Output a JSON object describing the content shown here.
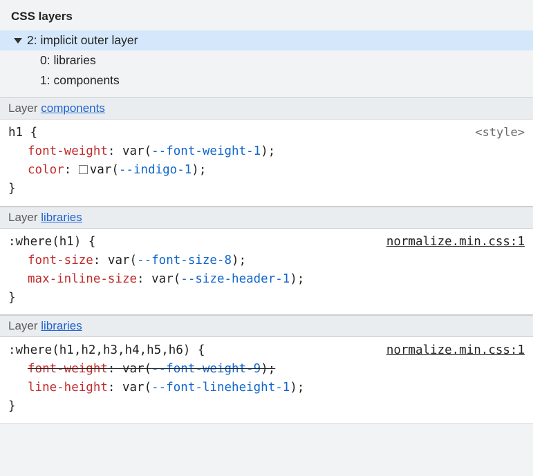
{
  "panel": {
    "title": "CSS layers"
  },
  "tree": {
    "root_label": "2: implicit outer layer",
    "children": [
      {
        "label": "0: libraries"
      },
      {
        "label": "1: components"
      }
    ]
  },
  "sections": [
    {
      "header_prefix": "Layer ",
      "header_link": "components",
      "selector": "h1 {",
      "source": "<style>",
      "source_is_link": false,
      "decls": [
        {
          "name": "font-weight",
          "val_prefix": "var(",
          "var": "--font-weight-1",
          "val_suffix": ");",
          "swatch": false,
          "strike": false
        },
        {
          "name": "color",
          "val_prefix": "var(",
          "var": "--indigo-1",
          "val_suffix": ");",
          "swatch": true,
          "strike": false
        }
      ],
      "close": "}"
    },
    {
      "header_prefix": "Layer ",
      "header_link": "libraries",
      "selector": ":where(h1) {",
      "source": "normalize.min.css:1",
      "source_is_link": true,
      "decls": [
        {
          "name": "font-size",
          "val_prefix": "var(",
          "var": "--font-size-8",
          "val_suffix": ");",
          "swatch": false,
          "strike": false
        },
        {
          "name": "max-inline-size",
          "val_prefix": "var(",
          "var": "--size-header-1",
          "val_suffix": ");",
          "swatch": false,
          "strike": false
        }
      ],
      "close": "}"
    },
    {
      "header_prefix": "Layer ",
      "header_link": "libraries",
      "selector": ":where(h1,h2,h3,h4,h5,h6) {",
      "source": "normalize.min.css:1",
      "source_is_link": true,
      "decls": [
        {
          "name": "font-weight",
          "val_prefix": "var(",
          "var": "--font-weight-9",
          "val_suffix": ");",
          "swatch": false,
          "strike": true
        },
        {
          "name": "line-height",
          "val_prefix": "var(",
          "var": "--font-lineheight-1",
          "val_suffix": ");",
          "swatch": false,
          "strike": false
        }
      ],
      "close": "}"
    }
  ]
}
